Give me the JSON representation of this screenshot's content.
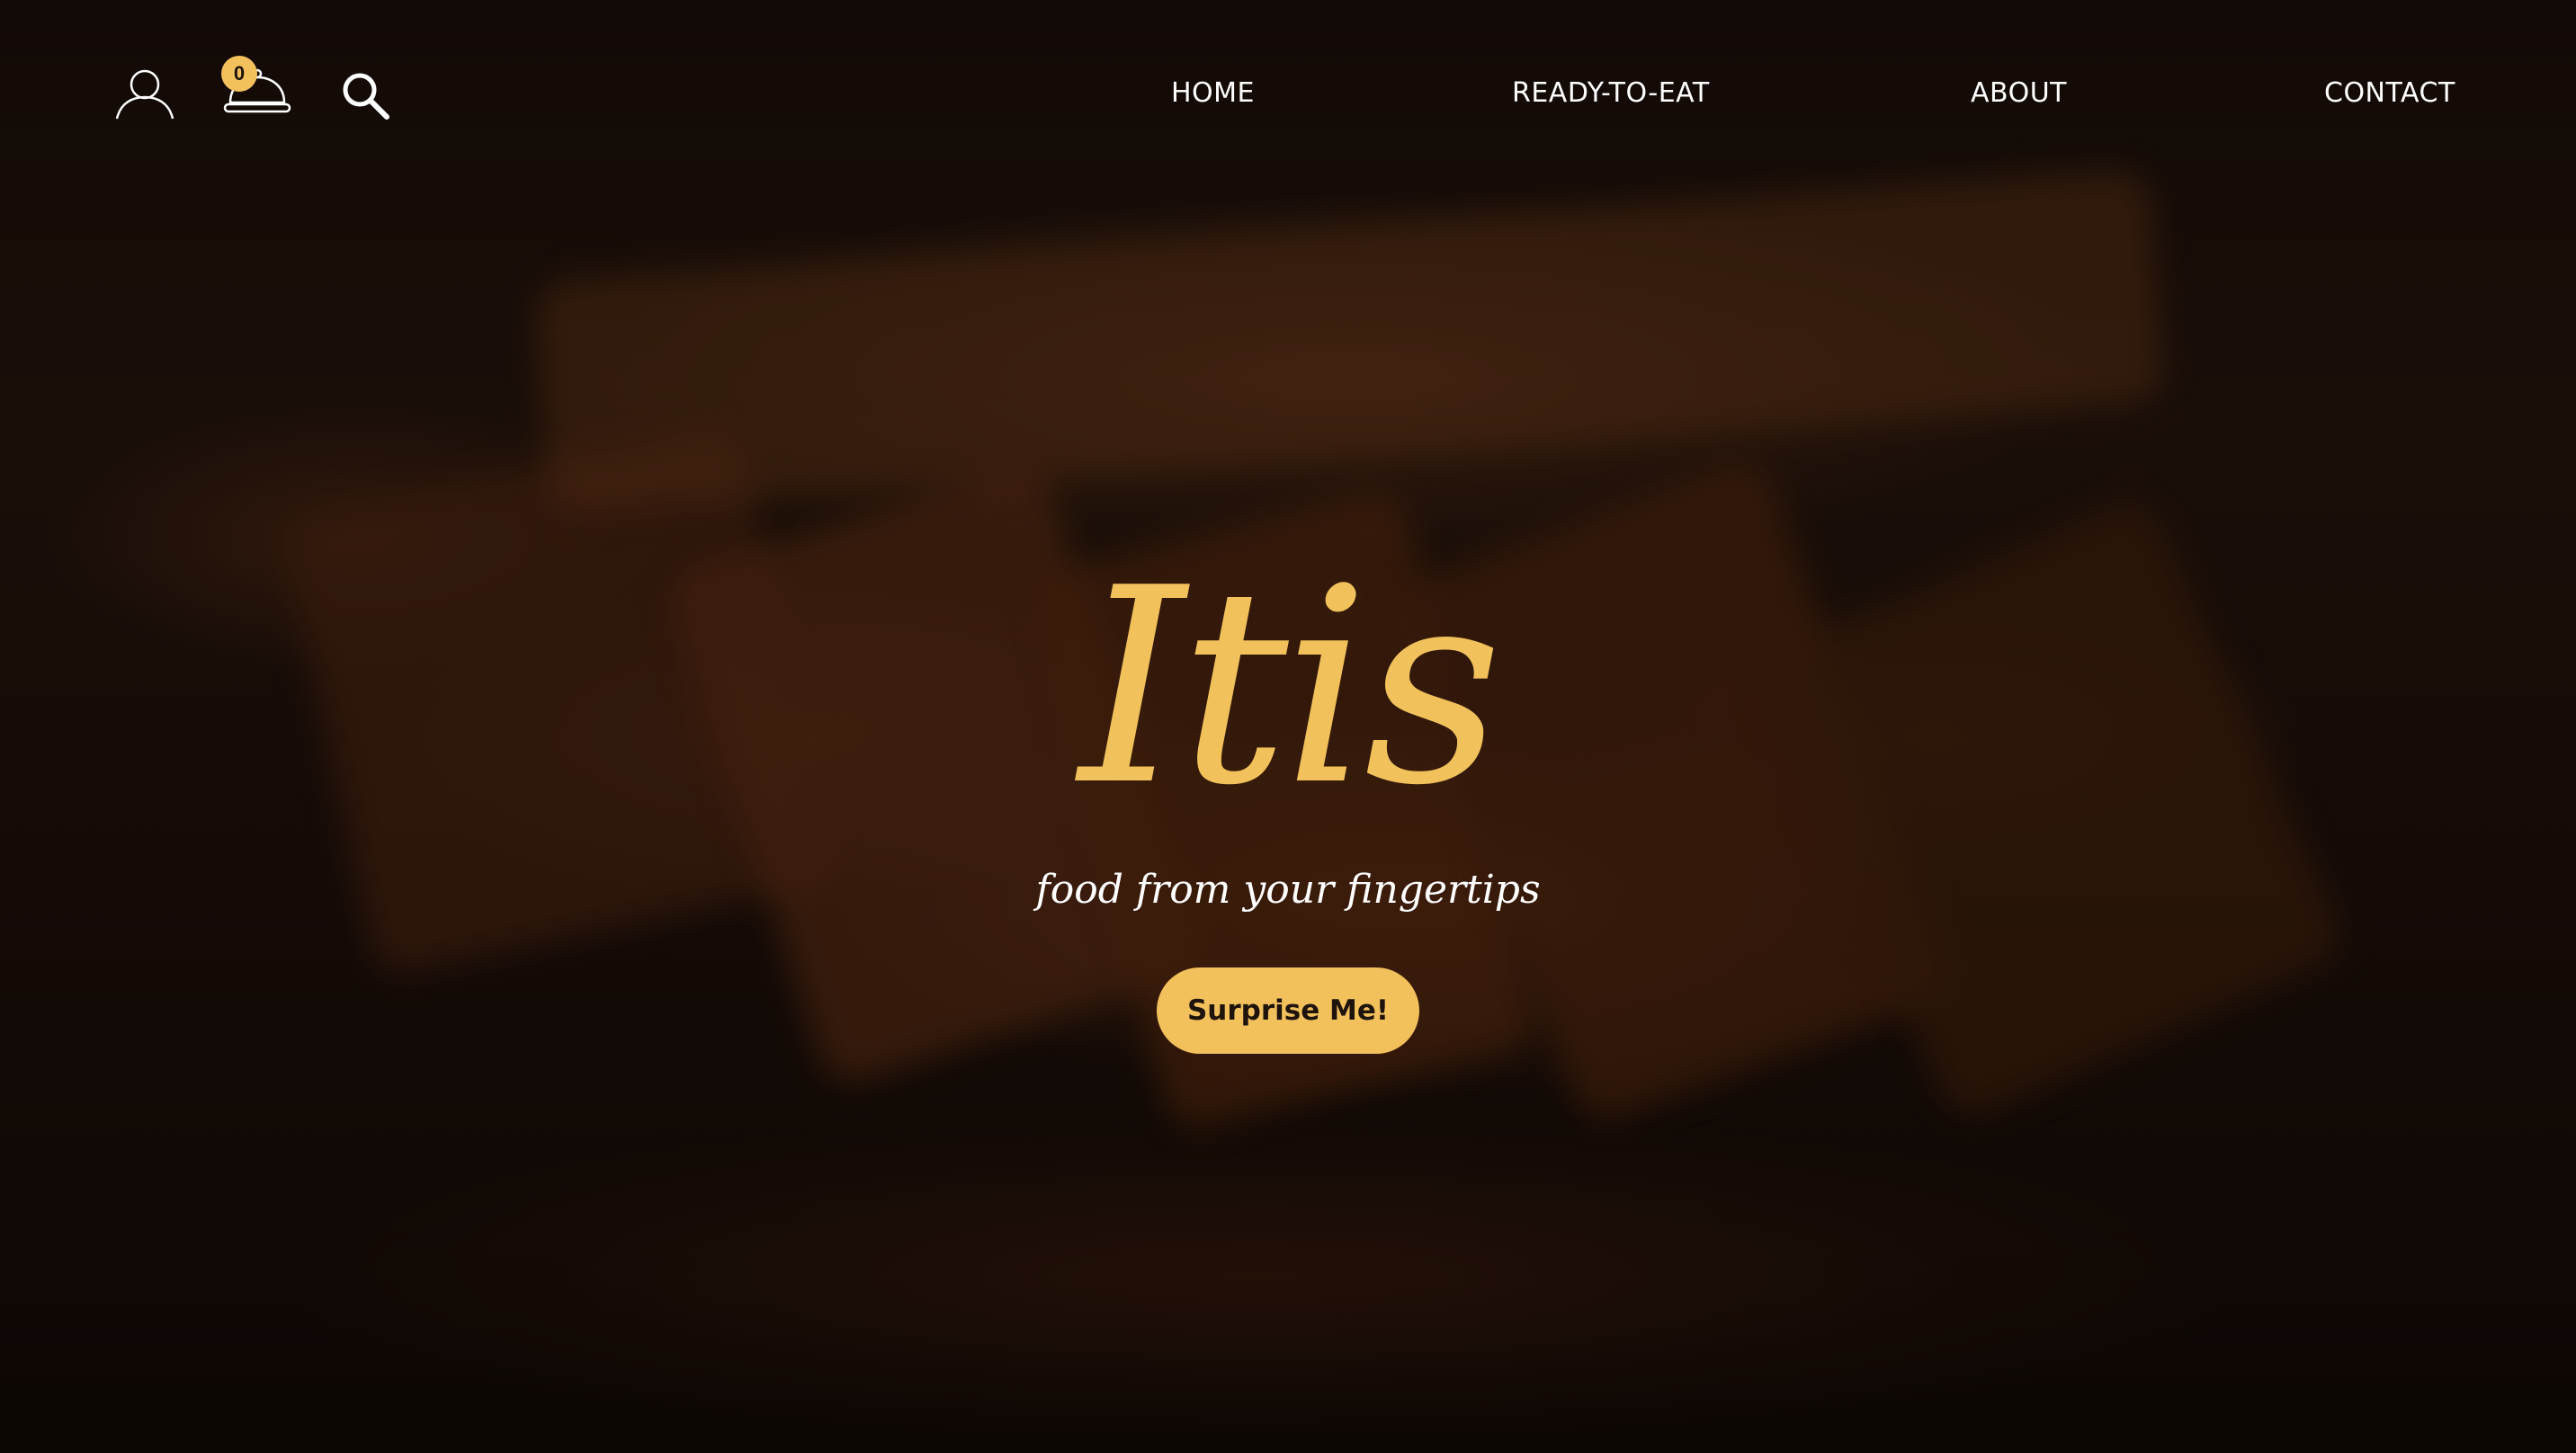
{
  "header": {
    "icons": {
      "account": "person-outline-icon",
      "cart": "cloche-icon",
      "search": "magnifier-icon"
    },
    "cart_count": "0",
    "nav": [
      {
        "label": "HOME"
      },
      {
        "label": "READY-TO-EAT"
      },
      {
        "label": "ABOUT"
      },
      {
        "label": "CONTACT"
      }
    ]
  },
  "hero": {
    "title": "Itis",
    "tagline": "food from your fingertips",
    "cta_label": "Surprise Me!"
  },
  "colors": {
    "accent": "#f3c15c",
    "text": "#ffffff",
    "background": "#1a0f0a"
  }
}
